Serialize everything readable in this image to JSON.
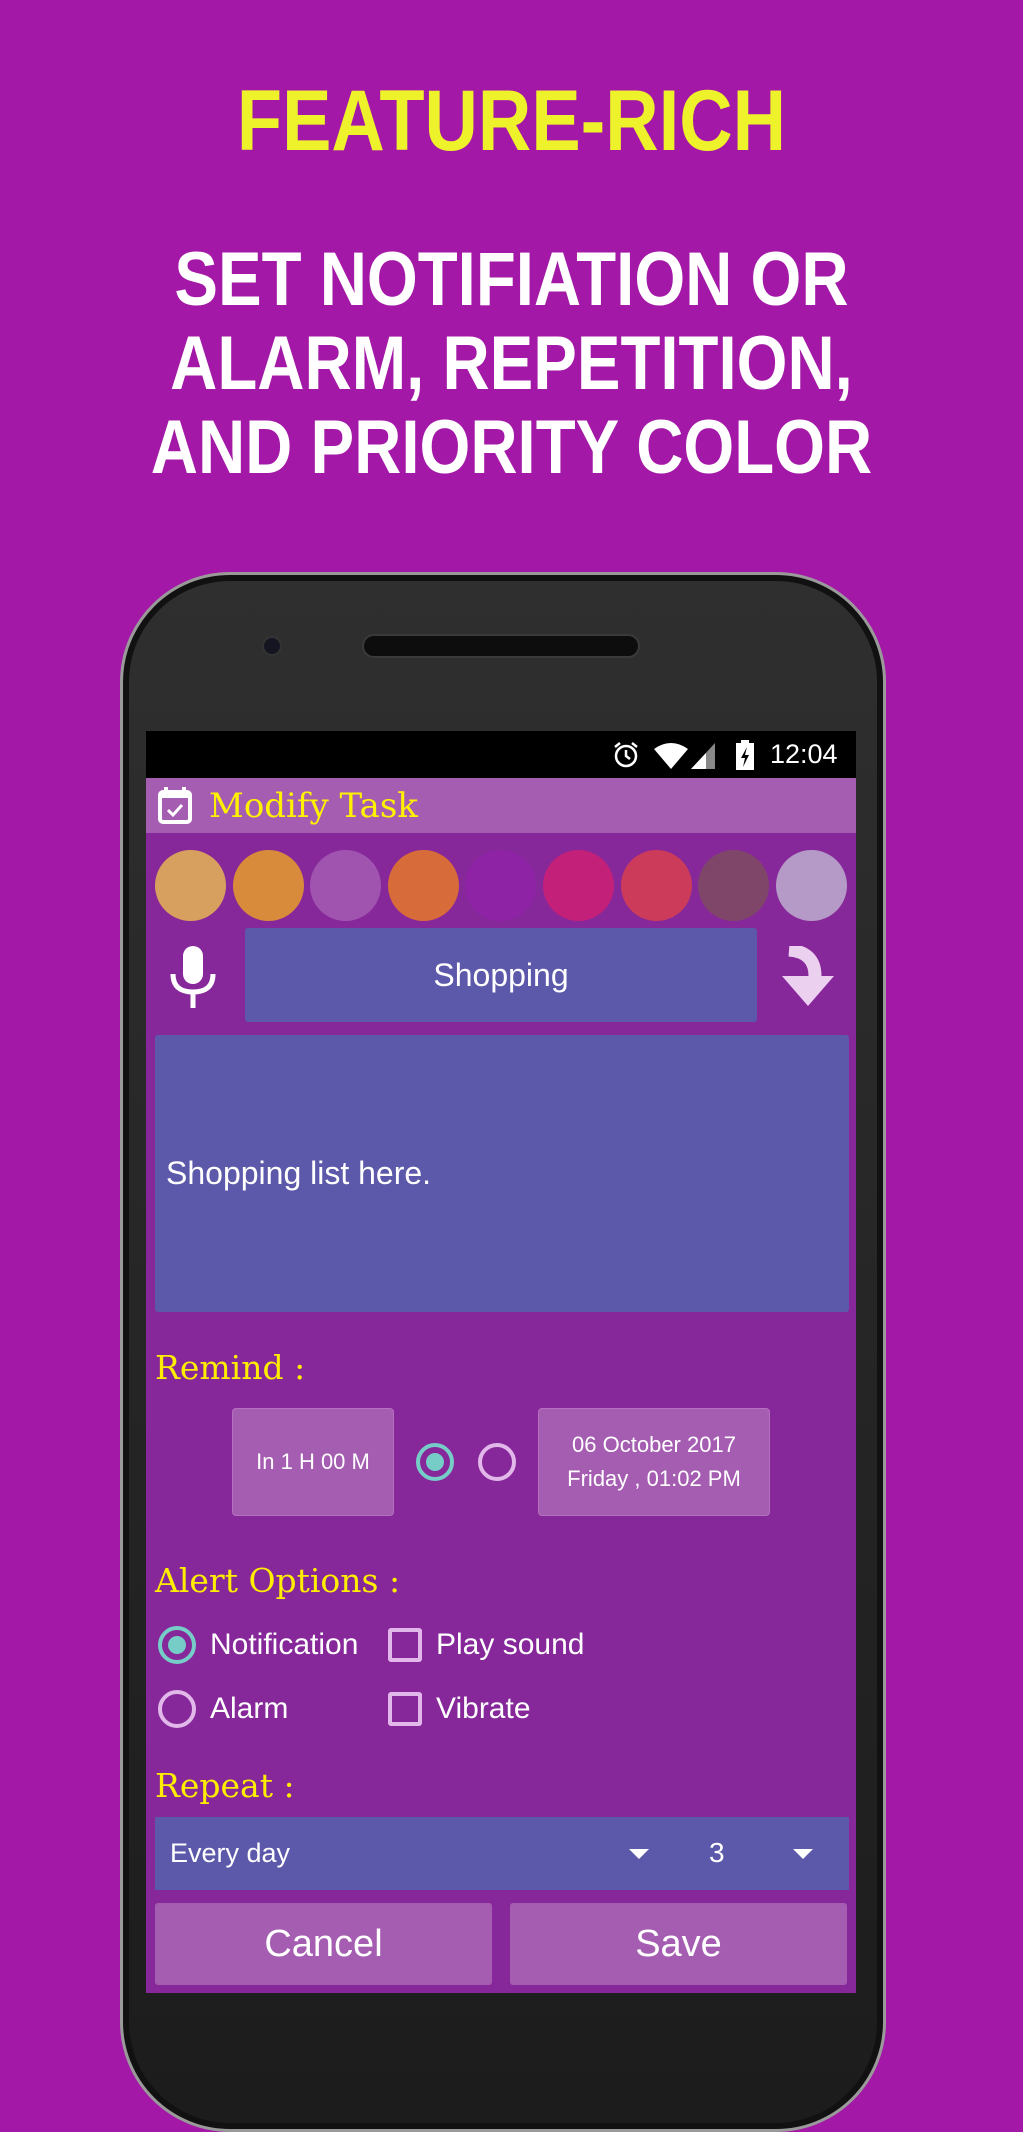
{
  "headline": "FEATURE-RICH",
  "subtitle": [
    "SET NOTIFIATION OR",
    "ALARM, REPETITION,",
    "AND PRIORITY COLOR"
  ],
  "status_bar": {
    "time": "12:04",
    "icons": [
      "alarm-icon",
      "wifi-icon",
      "signal-icon",
      "battery-charging-icon"
    ]
  },
  "app": {
    "title": "Modify Task",
    "title_icon": "calendar-check-icon",
    "priority_colors": [
      "#d7a05e",
      "#d88b3a",
      "#a153b0",
      "#d86b3a",
      "#8e23a6",
      "#c3207a",
      "#cc3b5a",
      "#80466a",
      "#b599c6"
    ],
    "task_name": "Shopping",
    "notes": "Shopping list here.",
    "remind": {
      "label": "Remind :",
      "relative": "In 1 H 00 M",
      "relative_selected": true,
      "date_line1": "06 October 2017",
      "date_line2": "Friday , 01:02 PM",
      "absolute_selected": false
    },
    "alert": {
      "label": "Alert Options :",
      "notification": "Notification",
      "alarm": "Alarm",
      "play_sound": "Play sound",
      "vibrate": "Vibrate",
      "notification_selected": true,
      "alarm_selected": false,
      "play_sound_checked": false,
      "vibrate_checked": false
    },
    "repeat": {
      "label": "Repeat :",
      "frequency": "Every day",
      "count": "3"
    },
    "cancel": "Cancel",
    "save": "Save"
  },
  "colors": {
    "background": "#a318a6",
    "headline": "#eef22a",
    "screen": "#86279a",
    "accent": "#ffee00",
    "input": "#5c58aa"
  }
}
